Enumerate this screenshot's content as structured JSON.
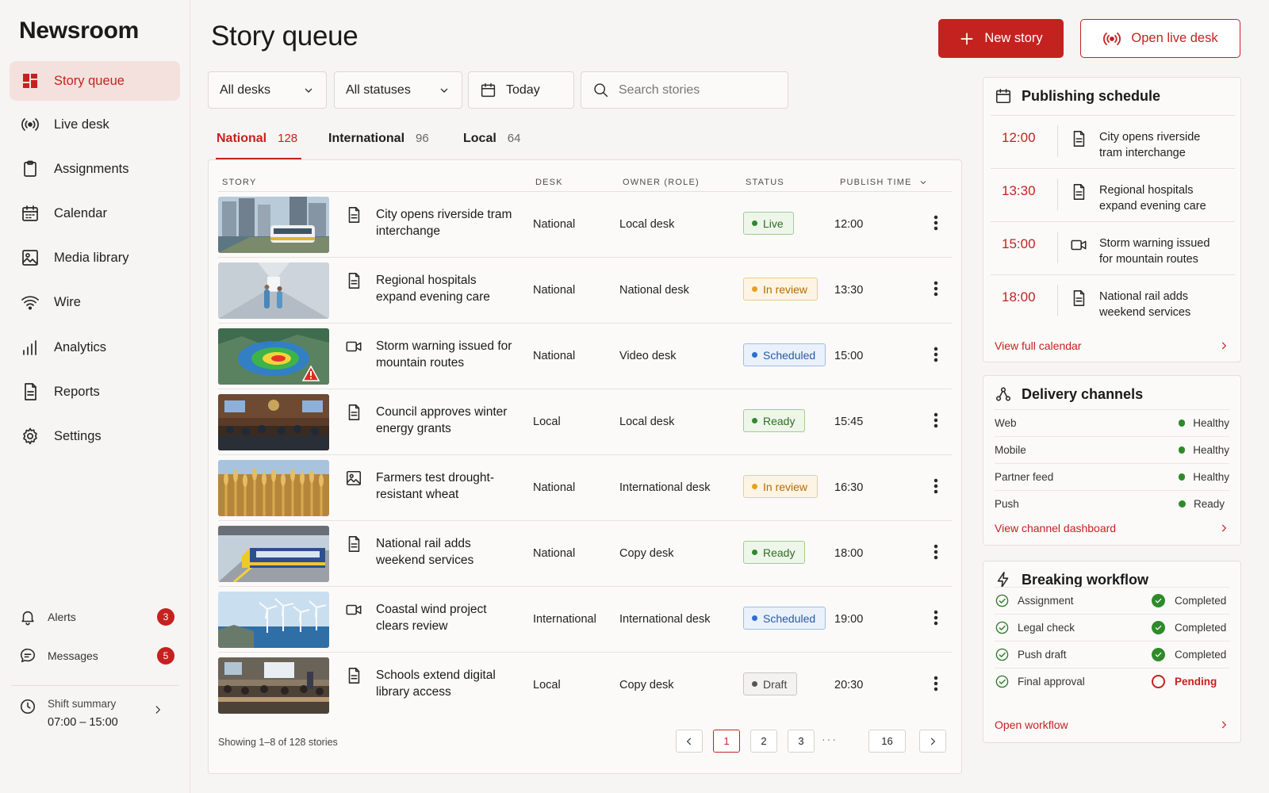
{
  "app": {
    "name": "Newsroom"
  },
  "sidebar": {
    "items": [
      {
        "label": "Story queue",
        "icon": "dashboard-icon"
      },
      {
        "label": "Live desk",
        "icon": "broadcast-icon"
      },
      {
        "label": "Assignments",
        "icon": "clipboard-icon"
      },
      {
        "label": "Calendar",
        "icon": "calendar-icon"
      },
      {
        "label": "Media library",
        "icon": "image-icon"
      },
      {
        "label": "Wire",
        "icon": "wifi-icon"
      },
      {
        "label": "Analytics",
        "icon": "bar-chart-icon"
      },
      {
        "label": "Reports",
        "icon": "document-icon"
      },
      {
        "label": "Settings",
        "icon": "gear-icon"
      }
    ],
    "alerts": {
      "label": "Alerts",
      "count": "3"
    },
    "messages": {
      "label": "Messages",
      "count": "5"
    },
    "shift": {
      "label": "Shift summary",
      "hours": "07:00 – 15:00"
    }
  },
  "header": {
    "title": "Story queue",
    "new_story": "New story",
    "open_live_desk": "Open live desk"
  },
  "filters": {
    "desk": "All desks",
    "status": "All statuses",
    "date": "Today",
    "search_placeholder": "Search stories"
  },
  "tabs": [
    {
      "label": "National",
      "count": "128"
    },
    {
      "label": "International",
      "count": "96"
    },
    {
      "label": "Local",
      "count": "64"
    }
  ],
  "table": {
    "columns": {
      "story": "STORY",
      "desk": "DESK",
      "owner": "OWNER (ROLE)",
      "status": "STATUS",
      "publish_time": "PUBLISH TIME"
    },
    "rows": [
      {
        "title": "City opens riverside tram interchange",
        "type": "article",
        "desk": "National",
        "owner": "Local desk",
        "status": "Live",
        "time": "12:00",
        "thumb": "tram"
      },
      {
        "title": "Regional hospitals expand evening care",
        "type": "article",
        "desk": "National",
        "owner": "National desk",
        "status": "In review",
        "time": "13:30",
        "thumb": "hospital"
      },
      {
        "title": "Storm warning issued for mountain routes",
        "type": "video",
        "desk": "National",
        "owner": "Video desk",
        "status": "Scheduled",
        "time": "15:00",
        "thumb": "storm"
      },
      {
        "title": "Council approves winter energy grants",
        "type": "article",
        "desk": "Local",
        "owner": "Local desk",
        "status": "Ready",
        "time": "15:45",
        "thumb": "council"
      },
      {
        "title": "Farmers test drought-resistant wheat",
        "type": "gallery",
        "desk": "National",
        "owner": "International desk",
        "status": "In review",
        "time": "16:30",
        "thumb": "wheat"
      },
      {
        "title": "National rail adds weekend services",
        "type": "article",
        "desk": "National",
        "owner": "Copy desk",
        "status": "Ready",
        "time": "18:00",
        "thumb": "train"
      },
      {
        "title": "Coastal wind project clears review",
        "type": "video",
        "desk": "International",
        "owner": "International desk",
        "status": "Scheduled",
        "time": "19:00",
        "thumb": "wind"
      },
      {
        "title": "Schools extend digital library access",
        "type": "article",
        "desk": "Local",
        "owner": "Copy desk",
        "status": "Draft",
        "time": "20:30",
        "thumb": "school"
      }
    ],
    "footer": "Showing 1–8 of 128 stories",
    "pages": [
      "1",
      "2",
      "3",
      "16"
    ],
    "ellipsis": "···",
    "current_page": "1"
  },
  "schedule": {
    "title": "Publishing schedule",
    "items": [
      {
        "time": "12:00",
        "type": "article",
        "title": "City opens riverside tram interchange"
      },
      {
        "time": "13:30",
        "type": "article",
        "title": "Regional hospitals expand evening care"
      },
      {
        "time": "15:00",
        "type": "video",
        "title": "Storm warning issued for mountain routes"
      },
      {
        "time": "18:00",
        "type": "article",
        "title": "National rail adds weekend services"
      }
    ],
    "link": "View full calendar"
  },
  "channels": {
    "title": "Delivery channels",
    "items": [
      {
        "name": "Web",
        "state": "Healthy"
      },
      {
        "name": "Mobile",
        "state": "Healthy"
      },
      {
        "name": "Partner feed",
        "state": "Healthy"
      },
      {
        "name": "Push",
        "state": "Ready"
      }
    ],
    "link": "View channel dashboard"
  },
  "workflow": {
    "title": "Breaking workflow",
    "steps": [
      {
        "name": "Assignment",
        "state": "Completed"
      },
      {
        "name": "Legal check",
        "state": "Completed"
      },
      {
        "name": "Push draft",
        "state": "Completed"
      },
      {
        "name": "Final approval",
        "state": "Pending"
      }
    ],
    "link": "Open workflow"
  },
  "colors": {
    "accent": "#c4221f",
    "healthy": "#2f8a2a",
    "review": "#e7a21a",
    "scheduled": "#2d6ed0"
  }
}
